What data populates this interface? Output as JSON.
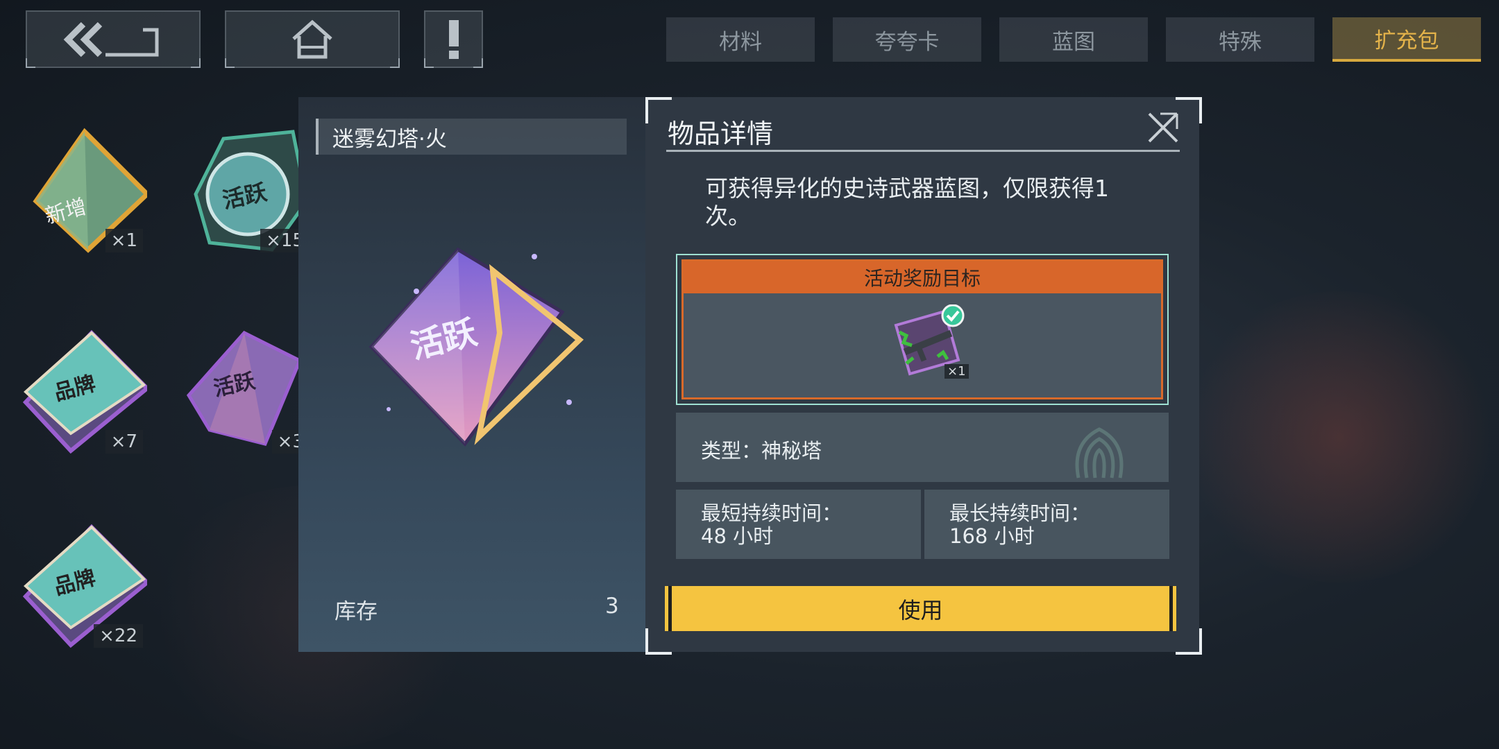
{
  "nav": {
    "back_icon": "double-chevron-left-icon",
    "home_icon": "home-icon",
    "alert_icon": "exclamation-icon"
  },
  "tabs": [
    {
      "label": "材料",
      "active": false
    },
    {
      "label": "夸夸卡",
      "active": false
    },
    {
      "label": "蓝图",
      "active": false
    },
    {
      "label": "特殊",
      "active": false
    },
    {
      "label": "扩充包",
      "active": true
    }
  ],
  "inventory": [
    {
      "label": "新增",
      "count": "×1",
      "color": "#e0a436"
    },
    {
      "label": "活跃",
      "count": "×15",
      "color": "#4fb39a"
    },
    {
      "label": "品牌",
      "count": "×7",
      "color": "#9b5fd0"
    },
    {
      "label": "活跃",
      "count": "×3",
      "color": "#9b5fd0"
    },
    {
      "label": "品牌",
      "count": "×22",
      "color": "#9b5fd0"
    }
  ],
  "item": {
    "name": "迷雾幻塔·火",
    "emblem": "活跃",
    "stock_label": "库存",
    "stock_value": "3"
  },
  "detail": {
    "title": "物品详情",
    "description": "可获得异化的史诗武器蓝图，仅限获得1次。",
    "reward_header": "活动奖励目标",
    "reward_count": "×1",
    "type_text": "类型：神秘塔",
    "min_duration_label": "最短持续时间：",
    "min_duration_value": "48 小时",
    "max_duration_label": "最长持续时间：",
    "max_duration_value": "168 小时",
    "use_label": "使用"
  },
  "colors": {
    "accent_yellow": "#f5c440",
    "reward_orange": "#d8662a",
    "active_tab": "#e4b34a"
  }
}
